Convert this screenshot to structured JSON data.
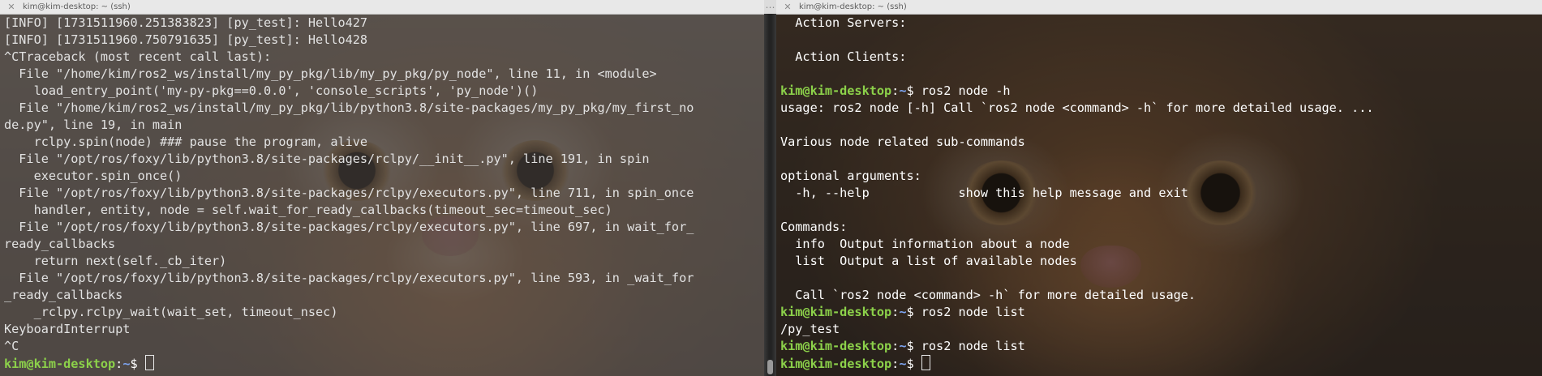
{
  "left": {
    "title": "kim@kim-desktop: ~ (ssh)",
    "lines": [
      "[INFO] [1731511960.251383823] [py_test]: Hello427",
      "[INFO] [1731511960.750791635] [py_test]: Hello428",
      "^CTraceback (most recent call last):",
      "  File \"/home/kim/ros2_ws/install/my_py_pkg/lib/my_py_pkg/py_node\", line 11, in <module>",
      "    load_entry_point('my-py-pkg==0.0.0', 'console_scripts', 'py_node')()",
      "  File \"/home/kim/ros2_ws/install/my_py_pkg/lib/python3.8/site-packages/my_py_pkg/my_first_no",
      "de.py\", line 19, in main",
      "    rclpy.spin(node) ### pause the program, alive",
      "  File \"/opt/ros/foxy/lib/python3.8/site-packages/rclpy/__init__.py\", line 191, in spin",
      "    executor.spin_once()",
      "  File \"/opt/ros/foxy/lib/python3.8/site-packages/rclpy/executors.py\", line 711, in spin_once",
      "    handler, entity, node = self.wait_for_ready_callbacks(timeout_sec=timeout_sec)",
      "  File \"/opt/ros/foxy/lib/python3.8/site-packages/rclpy/executors.py\", line 697, in wait_for_",
      "ready_callbacks",
      "    return next(self._cb_iter)",
      "  File \"/opt/ros/foxy/lib/python3.8/site-packages/rclpy/executors.py\", line 593, in _wait_for",
      "_ready_callbacks",
      "    _rclpy.rclpy_wait(wait_set, timeout_nsec)",
      "KeyboardInterrupt",
      "^C"
    ],
    "prompt": {
      "user": "kim@kim-desktop",
      "path": "~",
      "symbol": "$ "
    }
  },
  "right": {
    "title": "kim@kim-desktop: ~ (ssh)",
    "lines": [
      {
        "text": "  Action Servers:"
      },
      {
        "text": ""
      },
      {
        "text": "  Action Clients:"
      },
      {
        "text": ""
      },
      {
        "prompt": true,
        "cmd": "ros2 node -h"
      },
      {
        "text": "usage: ros2 node [-h] Call `ros2 node <command> -h` for more detailed usage. ..."
      },
      {
        "text": ""
      },
      {
        "text": "Various node related sub-commands"
      },
      {
        "text": ""
      },
      {
        "text": "optional arguments:"
      },
      {
        "text": "  -h, --help            show this help message and exit"
      },
      {
        "text": ""
      },
      {
        "text": "Commands:"
      },
      {
        "text": "  info  Output information about a node"
      },
      {
        "text": "  list  Output a list of available nodes"
      },
      {
        "text": ""
      },
      {
        "text": "  Call `ros2 node <command> -h` for more detailed usage."
      },
      {
        "prompt": true,
        "cmd": "ros2 node list"
      },
      {
        "text": "/py_test"
      },
      {
        "prompt": true,
        "cmd": "ros2 node list"
      }
    ],
    "prompt": {
      "user": "kim@kim-desktop",
      "path": "~",
      "symbol": "$ "
    }
  },
  "colors": {
    "prompt_user": "#8cd14a",
    "prompt_path": "#7ea6f3",
    "titlebar_bg": "#e8e8e8"
  },
  "icons": {
    "close": "close-icon",
    "split_options": "ellipsis-icon"
  }
}
